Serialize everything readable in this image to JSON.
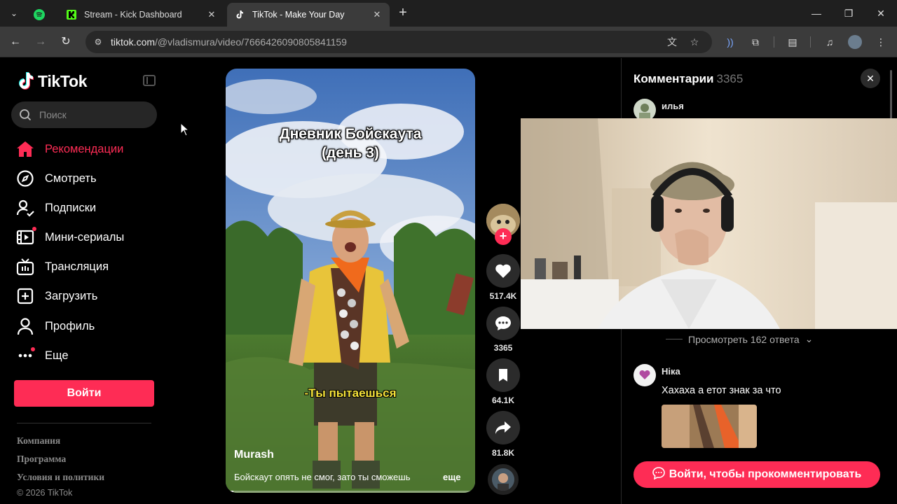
{
  "browser": {
    "tabs": [
      {
        "title": "",
        "icon": "spotify-icon",
        "pinned": true
      },
      {
        "title": "Stream - Kick Dashboard",
        "icon": "kick-icon"
      },
      {
        "title": "TikTok - Make Your Day",
        "icon": "tiktok-icon",
        "active": true
      }
    ],
    "url_domain": "tiktok.com",
    "url_path": "/@vladismura/video/7666426090805841159"
  },
  "sidebar": {
    "logo_text": "TikTok",
    "search_placeholder": "Поиск",
    "nav": [
      {
        "label": "Рекомендации",
        "icon": "home-icon",
        "active": true
      },
      {
        "label": "Смотреть",
        "icon": "compass-icon"
      },
      {
        "label": "Подписки",
        "icon": "following-icon"
      },
      {
        "label": "Мини-сериалы",
        "icon": "film-icon",
        "badge": true
      },
      {
        "label": "Трансляция",
        "icon": "live-tv-icon"
      },
      {
        "label": "Загрузить",
        "icon": "upload-icon"
      },
      {
        "label": "Профиль",
        "icon": "profile-icon"
      },
      {
        "label": "Еще",
        "icon": "more-icon",
        "badge": true
      }
    ],
    "login_label": "Войти",
    "footer_links": [
      "Компания",
      "Программа",
      "Условия и политики"
    ],
    "copyright": "© 2026 TikTok"
  },
  "video": {
    "title_line1": "Дневник Бойскаута",
    "title_line2": "(день 3)",
    "subtitle": "-Ты пытаешься",
    "author": "Murash",
    "description": "Бойскаут опять не смог, зато ты сможешь",
    "more_label": "еще",
    "progress": 0.03
  },
  "actions": {
    "likes": "517.4K",
    "comments": "3365",
    "saves": "64.1K",
    "shares": "81.8K"
  },
  "comments": {
    "header": "Комментарии",
    "count": "3365",
    "items": [
      {
        "author": "илья",
        "text": ""
      },
      {
        "author": "Ніка",
        "text": "Хахаха а етот знак за что"
      }
    ],
    "view_replies": "Просмотреть 162 ответа",
    "login_prompt": "Войти, чтобы прокомментировать"
  },
  "colors": {
    "accent": "#fe2c55",
    "background": "#000000",
    "chrome_tabbar": "#1f1f1f",
    "chrome_toolbar": "#3b3b3b"
  }
}
